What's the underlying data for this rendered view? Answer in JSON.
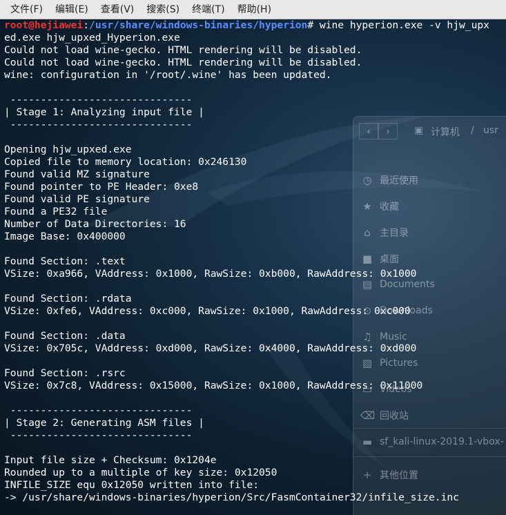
{
  "menubar": {
    "items": [
      "文件(F)",
      "编辑(E)",
      "查看(V)",
      "搜索(S)",
      "终端(T)",
      "帮助(H)"
    ]
  },
  "prompt": {
    "user_host": "root@hejiawei",
    "separator": ":",
    "path": "/usr/share/windows-binaries/hyperion",
    "symbol": "# ",
    "command": "wine hyperion.exe -v hjw_upx",
    "command_wrap": "ed.exe hjw_upxed_Hyperion.exe"
  },
  "output_lines": [
    "Could not load wine-gecko. HTML rendering will be disabled.",
    "Could not load wine-gecko. HTML rendering will be disabled.",
    "wine: configuration in '/root/.wine' has been updated.",
    "",
    " ------------------------------",
    "| Stage 1: Analyzing input file |",
    " ------------------------------",
    "",
    "Opening hjw_upxed.exe",
    "Copied file to memory location: 0x246130",
    "Found valid MZ signature",
    "Found pointer to PE Header: 0xe8",
    "Found valid PE signature",
    "Found a PE32 file",
    "Number of Data Directories: 16",
    "Image Base: 0x400000",
    "",
    "Found Section: .text",
    "VSize: 0xa966, VAddress: 0x1000, RawSize: 0xb000, RawAddress: 0x1000",
    "",
    "Found Section: .rdata",
    "VSize: 0xfe6, VAddress: 0xc000, RawSize: 0x1000, RawAddress: 0xc000",
    "",
    "Found Section: .data",
    "VSize: 0x705c, VAddress: 0xd000, RawSize: 0x4000, RawAddress: 0xd000",
    "",
    "Found Section: .rsrc",
    "VSize: 0x7c8, VAddress: 0x15000, RawSize: 0x1000, RawAddress: 0x11000",
    "",
    " ------------------------------",
    "| Stage 2: Generating ASM files |",
    " ------------------------------",
    "",
    "Input file size + Checksum: 0x1204e",
    "Rounded up to a multiple of key size: 0x12050",
    "INFILE_SIZE equ 0x12050 written into file:",
    "-> /usr/share/windows-binaries/hyperion/Src/FasmContainer32/infile_size.inc"
  ],
  "file_manager": {
    "back_icon": "chevron-left-icon",
    "forward_icon": "chevron-right-icon",
    "breadcrumb": [
      "计算机",
      "usr"
    ],
    "sidebar": [
      {
        "label": "最近使用",
        "icon": "clock-icon"
      },
      {
        "label": "收藏",
        "icon": "star-icon"
      },
      {
        "label": "主目录",
        "icon": "home-icon"
      },
      {
        "label": "桌面",
        "icon": "folder-icon"
      },
      {
        "label": "Documents",
        "icon": "document-icon"
      },
      {
        "label": "Downloads",
        "icon": "download-icon"
      },
      {
        "label": "Music",
        "icon": "music-icon"
      },
      {
        "label": "Pictures",
        "icon": "picture-icon"
      },
      {
        "label": "Videos",
        "icon": "video-icon"
      },
      {
        "label": "回收站",
        "icon": "trash-icon"
      },
      {
        "label": "sf_kali-linux-2019.1-vbox-",
        "icon": "drive-icon"
      },
      {
        "label": "其他位置",
        "icon": "plus-icon"
      }
    ]
  },
  "colors": {
    "prompt_user": "#f0322f",
    "prompt_path": "#5b8cff",
    "terminal_text": "#ffffff",
    "menubar_bg": "#e8e8e8"
  }
}
